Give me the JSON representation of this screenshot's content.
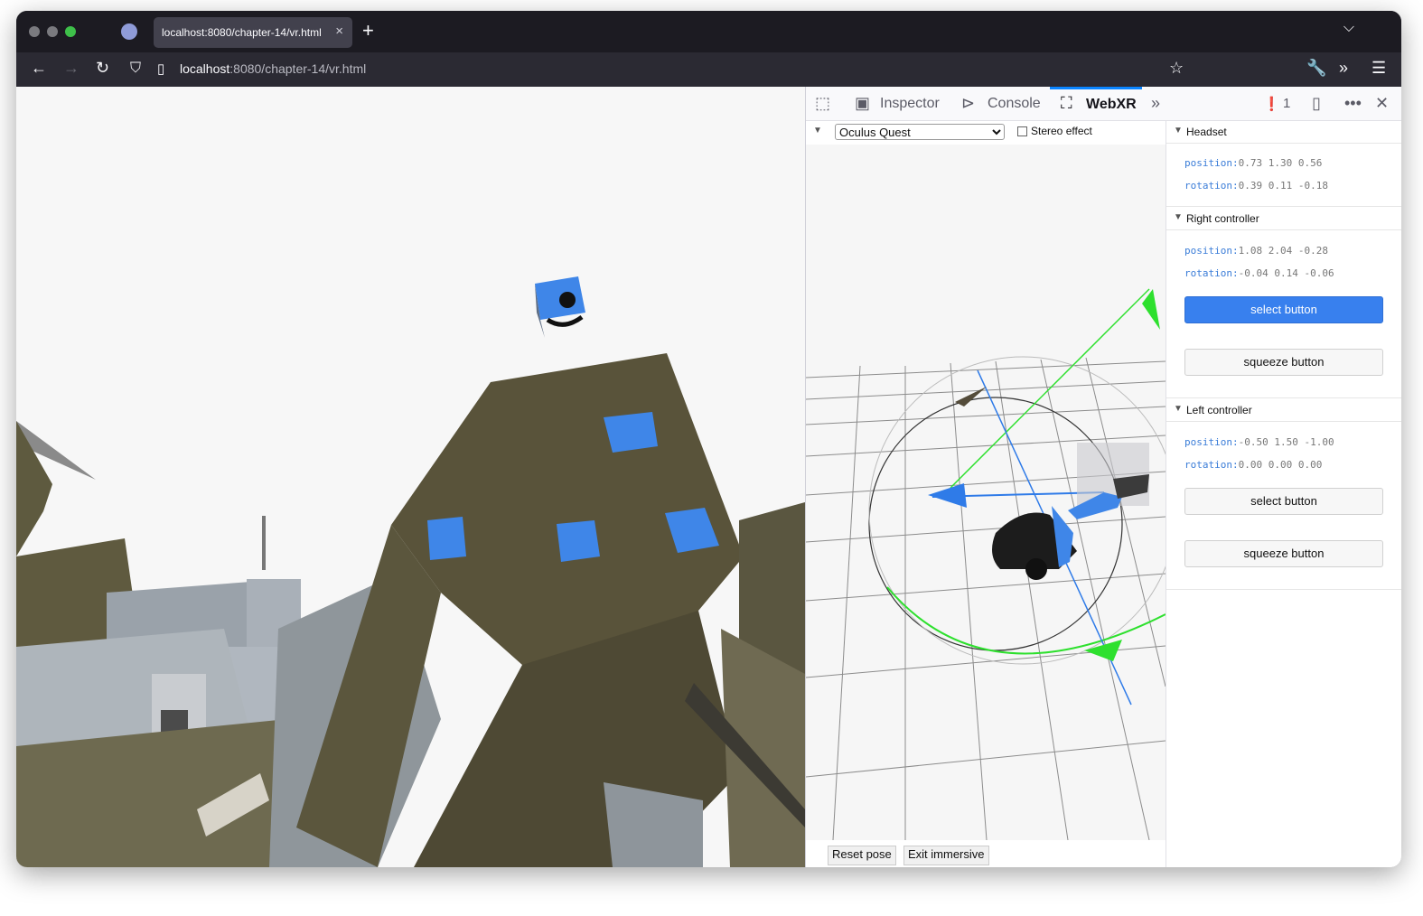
{
  "browser": {
    "tab_title": "localhost:8080/chapter-14/vr.html",
    "url_host": "localhost",
    "url_path": ":8080/chapter-14/vr.html"
  },
  "devtools": {
    "tabs": [
      "Inspector",
      "Console",
      "WebXR"
    ],
    "active_tab": "WebXR",
    "error_count": "1"
  },
  "webxr": {
    "device": "Oculus Quest",
    "stereo_label": "Stereo effect",
    "reset_pose": "Reset pose",
    "exit_immersive": "Exit immersive",
    "headset": {
      "title": "Headset",
      "position_label": "position:",
      "position": "0.73 1.30 0.56",
      "rotation_label": "rotation:",
      "rotation": "0.39 0.11 -0.18"
    },
    "right": {
      "title": "Right controller",
      "position_label": "position:",
      "position": "1.08 2.04 -0.28",
      "rotation_label": "rotation:",
      "rotation": "-0.04 0.14 -0.06",
      "select": "select button",
      "squeeze": "squeeze button"
    },
    "left": {
      "title": "Left controller",
      "position_label": "position:",
      "position": "-0.50 1.50 -1.00",
      "rotation_label": "rotation:",
      "rotation": "0.00 0.00 0.00",
      "select": "select button",
      "squeeze": "squeeze button"
    }
  },
  "colors": {
    "accent": "#3880ee",
    "chrome_dark": "#1c1b22",
    "terrain": "#585339"
  }
}
